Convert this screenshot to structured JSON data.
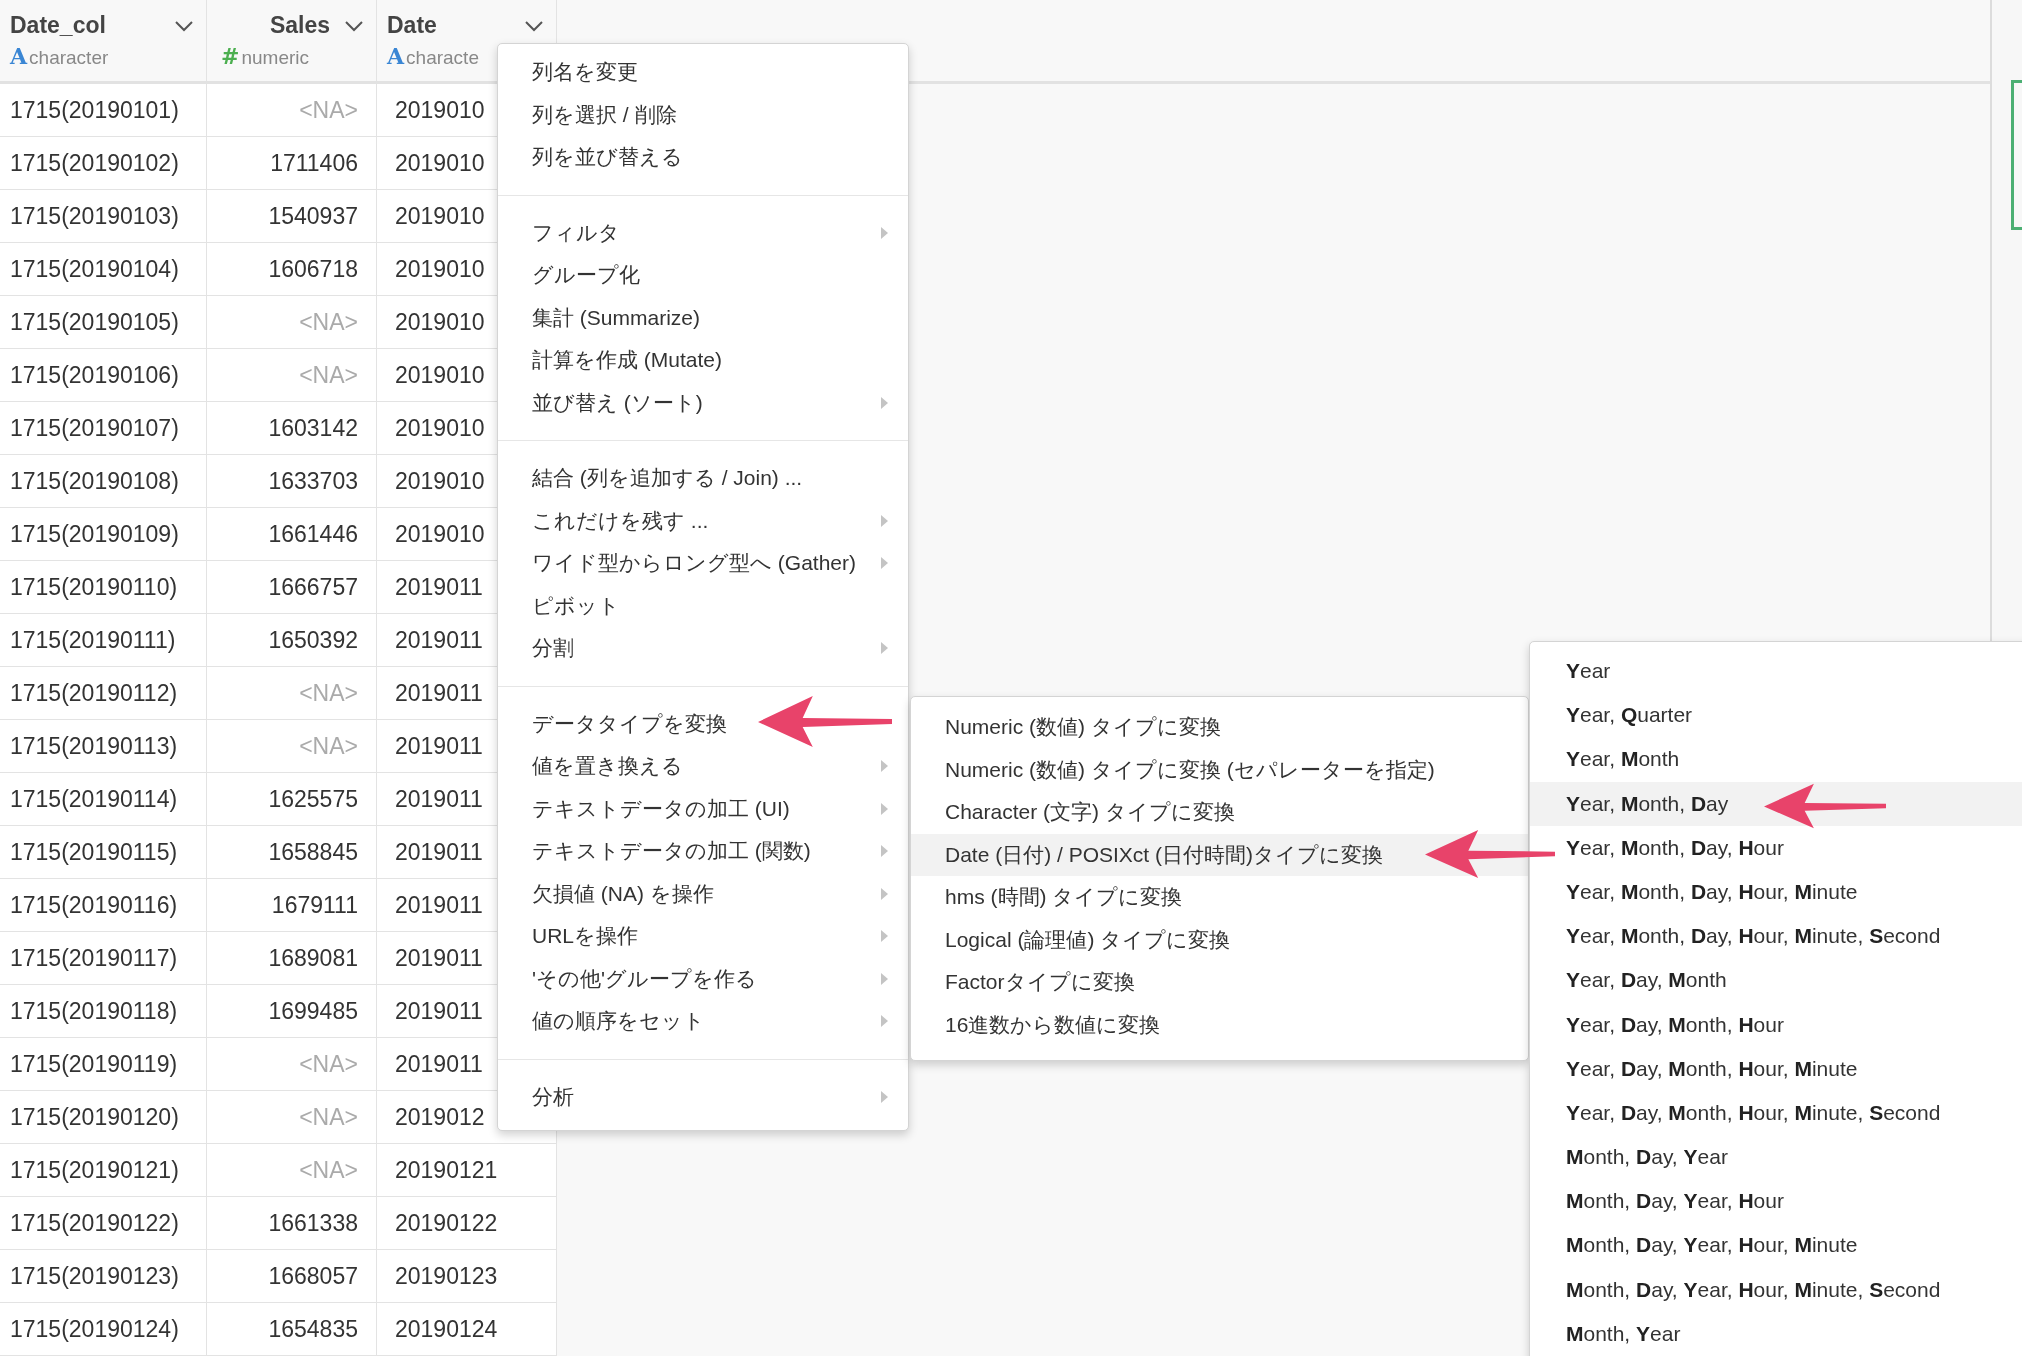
{
  "table": {
    "columns": [
      {
        "name": "Date_col",
        "type_icon": "A",
        "type": "character",
        "color": "#3a86d4",
        "kind": "text"
      },
      {
        "name": "Sales",
        "type_icon": "#",
        "type": "numeric",
        "color": "#4caf50",
        "kind": "numeric"
      },
      {
        "name": "Date",
        "type_icon": "A",
        "type": "characte",
        "color": "#3a86d4",
        "kind": "text"
      }
    ],
    "rows": [
      {
        "date_col": "1715(20190101)",
        "sales": "<NA>",
        "missing": true,
        "date": "2019010"
      },
      {
        "date_col": "1715(20190102)",
        "sales": "1711406",
        "missing": false,
        "date": "2019010"
      },
      {
        "date_col": "1715(20190103)",
        "sales": "1540937",
        "missing": false,
        "date": "2019010"
      },
      {
        "date_col": "1715(20190104)",
        "sales": "1606718",
        "missing": false,
        "date": "2019010"
      },
      {
        "date_col": "1715(20190105)",
        "sales": "<NA>",
        "missing": true,
        "date": "2019010"
      },
      {
        "date_col": "1715(20190106)",
        "sales": "<NA>",
        "missing": true,
        "date": "2019010"
      },
      {
        "date_col": "1715(20190107)",
        "sales": "1603142",
        "missing": false,
        "date": "2019010"
      },
      {
        "date_col": "1715(20190108)",
        "sales": "1633703",
        "missing": false,
        "date": "2019010"
      },
      {
        "date_col": "1715(20190109)",
        "sales": "1661446",
        "missing": false,
        "date": "2019010"
      },
      {
        "date_col": "1715(20190110)",
        "sales": "1666757",
        "missing": false,
        "date": "2019011"
      },
      {
        "date_col": "1715(20190111)",
        "sales": "1650392",
        "missing": false,
        "date": "2019011"
      },
      {
        "date_col": "1715(20190112)",
        "sales": "<NA>",
        "missing": true,
        "date": "2019011"
      },
      {
        "date_col": "1715(20190113)",
        "sales": "<NA>",
        "missing": true,
        "date": "2019011"
      },
      {
        "date_col": "1715(20190114)",
        "sales": "1625575",
        "missing": false,
        "date": "2019011"
      },
      {
        "date_col": "1715(20190115)",
        "sales": "1658845",
        "missing": false,
        "date": "2019011"
      },
      {
        "date_col": "1715(20190116)",
        "sales": "1679111",
        "missing": false,
        "date": "2019011"
      },
      {
        "date_col": "1715(20190117)",
        "sales": "1689081",
        "missing": false,
        "date": "2019011"
      },
      {
        "date_col": "1715(20190118)",
        "sales": "1699485",
        "missing": false,
        "date": "2019011"
      },
      {
        "date_col": "1715(20190119)",
        "sales": "<NA>",
        "missing": true,
        "date": "2019011"
      },
      {
        "date_col": "1715(20190120)",
        "sales": "<NA>",
        "missing": true,
        "date": "2019012"
      },
      {
        "date_col": "1715(20190121)",
        "sales": "<NA>",
        "missing": true,
        "date": "20190121"
      },
      {
        "date_col": "1715(20190122)",
        "sales": "1661338",
        "missing": false,
        "date": "20190122"
      },
      {
        "date_col": "1715(20190123)",
        "sales": "1668057",
        "missing": false,
        "date": "20190123"
      },
      {
        "date_col": "1715(20190124)",
        "sales": "1654835",
        "missing": false,
        "date": "20190124"
      }
    ]
  },
  "context_menu": {
    "groups": [
      [
        {
          "label": "列名を変更",
          "submenu": false,
          "selected": false
        },
        {
          "label": "列を選択 / 削除",
          "submenu": false,
          "selected": false
        },
        {
          "label": "列を並び替える",
          "submenu": false,
          "selected": false
        }
      ],
      [
        {
          "label": "フィルタ",
          "submenu": true,
          "selected": false
        },
        {
          "label": "グループ化",
          "submenu": false,
          "selected": false
        },
        {
          "label": "集計 (Summarize)",
          "submenu": false,
          "selected": false
        },
        {
          "label": "計算を作成 (Mutate)",
          "submenu": false,
          "selected": false
        },
        {
          "label": "並び替え (ソート)",
          "submenu": true,
          "selected": false
        }
      ],
      [
        {
          "label": "結合 (列を追加する / Join) ...",
          "submenu": false,
          "selected": false
        },
        {
          "label": "これだけを残す ...",
          "submenu": true,
          "selected": false
        },
        {
          "label": "ワイド型からロング型へ (Gather)",
          "submenu": true,
          "selected": false
        },
        {
          "label": "ピボット",
          "submenu": false,
          "selected": false
        },
        {
          "label": "分割",
          "submenu": true,
          "selected": false
        }
      ],
      [
        {
          "label": "データタイプを変換",
          "submenu": false,
          "selected": false
        },
        {
          "label": "値を置き換える",
          "submenu": true,
          "selected": false
        },
        {
          "label": "テキストデータの加工 (UI)",
          "submenu": true,
          "selected": false
        },
        {
          "label": "テキストデータの加工 (関数)",
          "submenu": true,
          "selected": false
        },
        {
          "label": "欠損値 (NA) を操作",
          "submenu": true,
          "selected": false
        },
        {
          "label": "URLを操作",
          "submenu": true,
          "selected": false
        },
        {
          "label": "'その他'グループを作る",
          "submenu": true,
          "selected": false
        },
        {
          "label": "値の順序をセット",
          "submenu": true,
          "selected": false
        }
      ],
      [
        {
          "label": "分析",
          "submenu": true,
          "selected": false
        }
      ]
    ]
  },
  "type_submenu": {
    "items": [
      {
        "label": "Numeric (数値) タイプに変換",
        "selected": false
      },
      {
        "label": "Numeric (数値) タイプに変換 (セパレーターを指定)",
        "selected": false
      },
      {
        "label": "Character (文字) タイプに変換",
        "selected": false
      },
      {
        "label": "Date (日付) / POSIXct (日付時間)タイプに変換",
        "selected": true
      },
      {
        "label": "hms (時間) タイプに変換",
        "selected": false
      },
      {
        "label": "Logical (論理値) タイプに変換",
        "selected": false
      },
      {
        "label": "Factorタイプに変換",
        "selected": false
      },
      {
        "label": "16進数から数値に変換",
        "selected": false
      }
    ]
  },
  "date_format_submenu": {
    "items": [
      {
        "label": "**Y**ear",
        "selected": false
      },
      {
        "label": "**Y**ear, **Q**uarter",
        "selected": false
      },
      {
        "label": "**Y**ear, **M**onth",
        "selected": false
      },
      {
        "label": "**Y**ear, **M**onth, **D**ay",
        "selected": true
      },
      {
        "label": "**Y**ear, **M**onth, **D**ay, **H**our",
        "selected": false
      },
      {
        "label": "**Y**ear, **M**onth, **D**ay, **H**our, **M**inute",
        "selected": false
      },
      {
        "label": "**Y**ear, **M**onth, **D**ay, **H**our, **M**inute, **S**econd",
        "selected": false
      },
      {
        "label": "**Y**ear, **D**ay, **M**onth",
        "selected": false
      },
      {
        "label": "**Y**ear, **D**ay, **M**onth, **H**our",
        "selected": false
      },
      {
        "label": "**Y**ear, **D**ay, **M**onth, **H**our, **M**inute",
        "selected": false
      },
      {
        "label": "**Y**ear, **D**ay, **M**onth, **H**our, **M**inute, **S**econd",
        "selected": false
      },
      {
        "label": "**M**onth, **D**ay, **Y**ear",
        "selected": false
      },
      {
        "label": "**M**onth, **D**ay, **Y**ear, **H**our",
        "selected": false
      },
      {
        "label": "**M**onth, **D**ay, **Y**ear, **H**our, **M**inute",
        "selected": false
      },
      {
        "label": "**M**onth, **D**ay, **Y**ear, **H**our, **M**inute, **S**econd",
        "selected": false
      },
      {
        "label": "**M**onth, **Y**ear",
        "selected": false
      }
    ]
  }
}
